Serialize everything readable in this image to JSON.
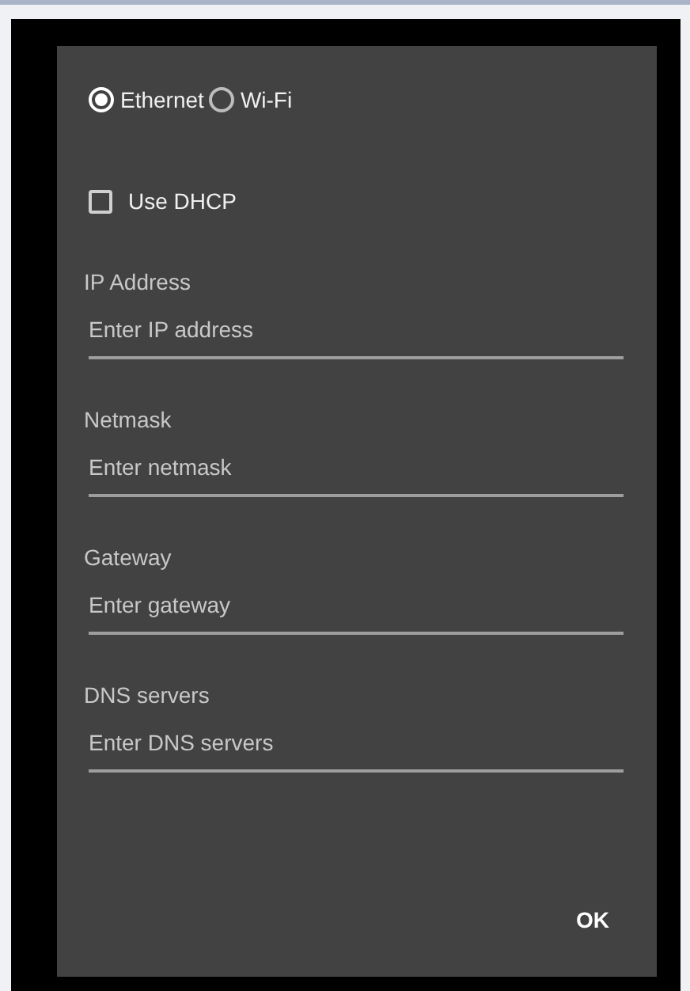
{
  "dialog": {
    "connection_types": [
      {
        "label": "Ethernet",
        "selected": true
      },
      {
        "label": "Wi-Fi",
        "selected": false
      }
    ],
    "dhcp": {
      "label": "Use DHCP",
      "checked": false
    },
    "fields": [
      {
        "label": "IP Address",
        "placeholder": "Enter IP address"
      },
      {
        "label": "Netmask",
        "placeholder": "Enter netmask"
      },
      {
        "label": "Gateway",
        "placeholder": "Enter gateway"
      },
      {
        "label": "DNS servers",
        "placeholder": "Enter DNS servers"
      }
    ],
    "buttons": [
      "OK"
    ]
  }
}
